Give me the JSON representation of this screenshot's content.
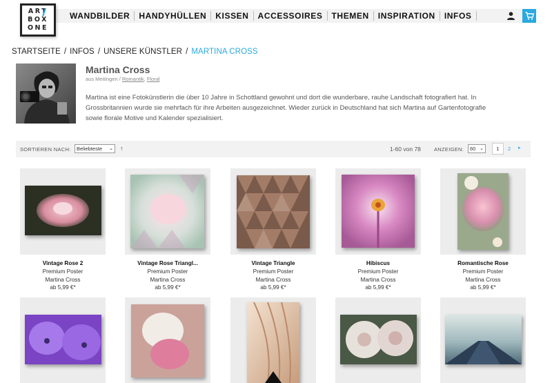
{
  "logo": {
    "line1": "ART",
    "line2": "BOX",
    "line3": "ONE"
  },
  "nav": {
    "items": [
      "WANDBILDER",
      "HANDYHÜLLEN",
      "KISSEN",
      "ACCESSOIRES",
      "THEMEN",
      "INSPIRATION",
      "INFOS"
    ]
  },
  "colors": {
    "accent": "#29a9e0",
    "bar": "#f2f2f2",
    "tile": "#ececec"
  },
  "icons": {
    "user": "user-icon",
    "cart": "cart-icon"
  },
  "breadcrumb": [
    "STARTSEITE",
    "INFOS",
    "UNSERE KÜNSTLER",
    "MARTINA CROSS"
  ],
  "artist": {
    "name": "Martina Cross",
    "location": "aus Meitingen / ",
    "tags": [
      "Romantik",
      "Floral"
    ],
    "bio": "Martina ist eine Fotokünstlerin die über 10 Jahre in Schottland gewohnt und dort die wunderbare, rauhe Landschaft fotografiert hat. In Grossbritannien wurde sie mehrfach für ihre Arbeiten ausgezeichnet. Wieder zurück in Deutschland hat sich Martina auf Gartenfotografie sowie florale Motive und Kalender spezialisiert."
  },
  "sorting": {
    "label": "SORTIEREN NACH:",
    "selected": "Beliebteste",
    "count_text": "1-60 von 78",
    "show_label": "ANZEIGEN:",
    "show_selected": "60",
    "pages": [
      "1",
      "2"
    ]
  },
  "products": [
    {
      "title": "Vintage Rose 2",
      "type": "Premium Poster",
      "artist": "Martina Cross",
      "price": "ab 5,99 €*"
    },
    {
      "title": "Vintage Rose Triangl...",
      "type": "Premium Poster",
      "artist": "Martina Cross",
      "price": "ab 5,99 €*"
    },
    {
      "title": "Vintage Triangle",
      "type": "Premium Poster",
      "artist": "Martina Cross",
      "price": "ab 5,99 €*"
    },
    {
      "title": "Hibiscus",
      "type": "Premium Poster",
      "artist": "Martina Cross",
      "price": "ab 5,99 €*"
    },
    {
      "title": "Romantische Rose",
      "type": "Premium Poster",
      "artist": "Martina Cross",
      "price": "ab 5,99 €*"
    }
  ]
}
